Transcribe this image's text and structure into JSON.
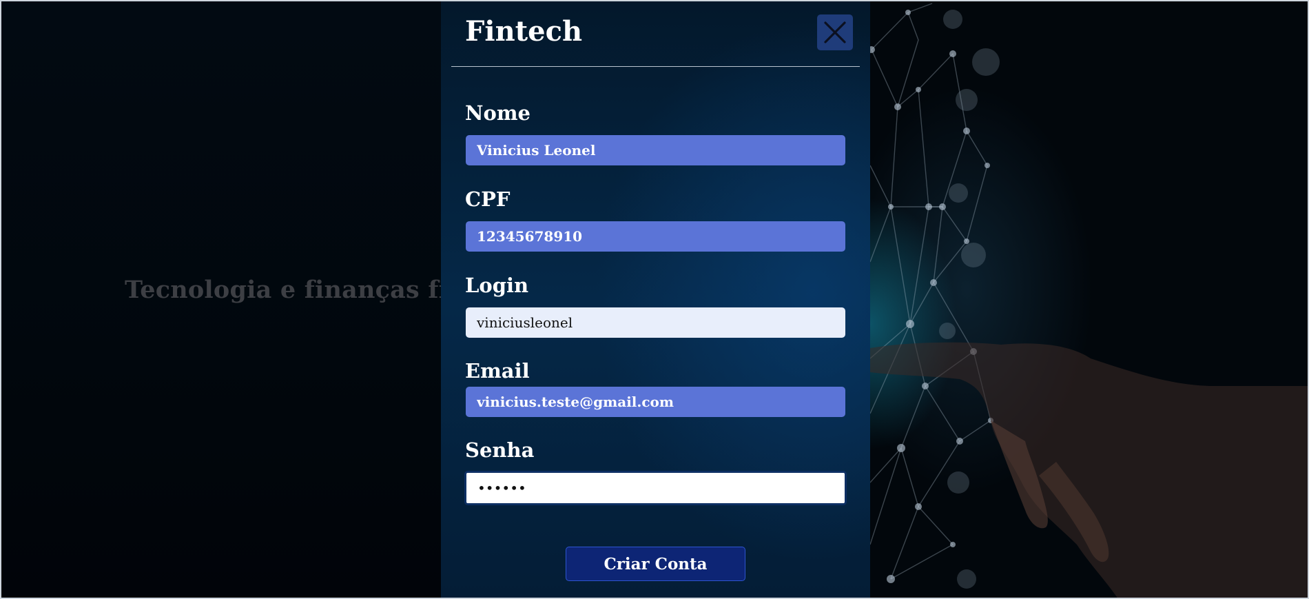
{
  "background": {
    "tagline": "Tecnologia e finanças finalm"
  },
  "modal": {
    "title": "Fintech",
    "close_icon": "close-icon",
    "fields": [
      {
        "label": "Nome",
        "value": "Vinicius Leonel",
        "type": "text"
      },
      {
        "label": "CPF",
        "value": "12345678910",
        "type": "text"
      },
      {
        "label": "Login",
        "value": "viniciusleonel",
        "type": "text"
      },
      {
        "label": "Email",
        "value": "vinicius.teste@gmail.com",
        "type": "email"
      },
      {
        "label": "Senha",
        "value": "••••••",
        "type": "password"
      }
    ],
    "submit_label": "Criar Conta"
  },
  "colors": {
    "modal_bg": "#052848",
    "filled_input": "#5b74d7",
    "light_input": "#e8eefb",
    "button": "#0d2575",
    "close_button": "#1f3c7a"
  }
}
